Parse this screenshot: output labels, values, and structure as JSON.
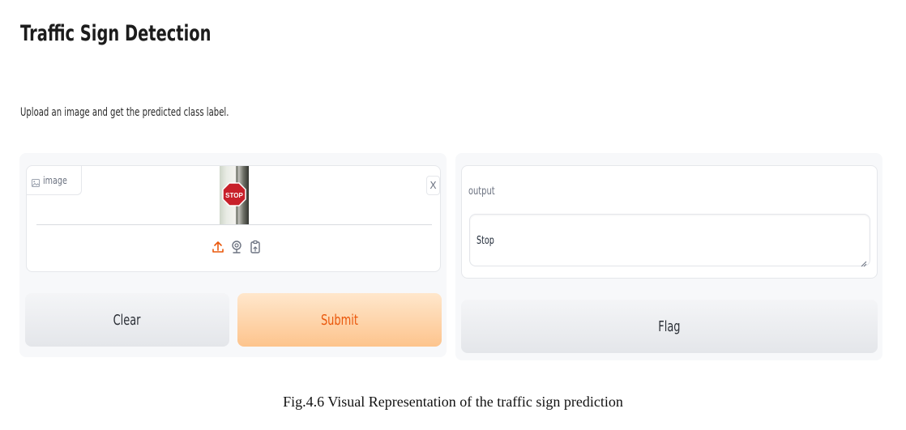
{
  "app": {
    "title": "Traffic Sign Detection",
    "description": "Upload an image and get the predicted class label."
  },
  "input": {
    "label": "image",
    "label_icon": "image-icon",
    "close_label": "X",
    "preview_sign_text": "STOP",
    "source_icons": [
      "upload-icon",
      "webcam-icon",
      "clipboard-icon"
    ]
  },
  "buttons": {
    "clear_label": "Clear",
    "submit_label": "Submit",
    "flag_label": "Flag"
  },
  "output": {
    "label": "output",
    "value": "Stop"
  },
  "caption": "Fig.4.6 Visual Representation of the traffic sign prediction",
  "colors": {
    "accent": "#ea580c",
    "submit_bg": "#fdc48d",
    "panel_bg": "#f7f8fa"
  }
}
